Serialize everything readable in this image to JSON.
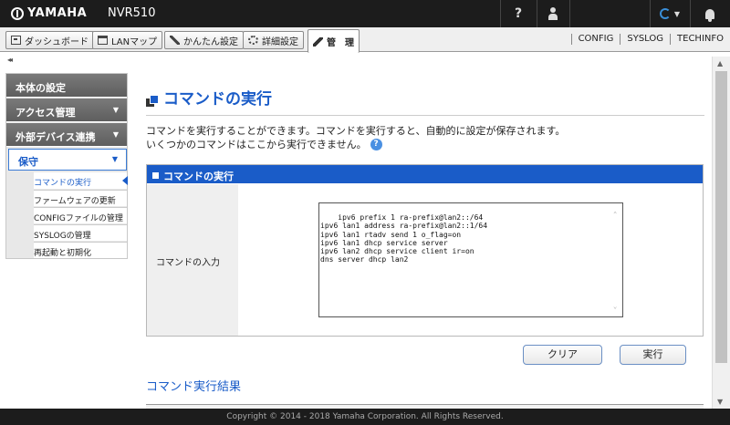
{
  "topbar": {
    "brand": "YAMAHA",
    "device": "NVR510",
    "help_label": "?",
    "icons": [
      "yamaha-logo-icon",
      "help-icon",
      "user-icon",
      "status-spinner-icon",
      "bell-icon"
    ],
    "colors": {
      "topbar_bg": "#1c1c1c",
      "accent": "#1a5cc8"
    }
  },
  "menubar": {
    "buttons": [
      "ダッシュボード",
      "LANマップ",
      "かんたん設定",
      "詳細設定",
      "管　理"
    ],
    "links": [
      "CONFIG",
      "SYSLOG",
      "TECHINFO"
    ]
  },
  "sidebar": {
    "collapse": "◂◂",
    "items": [
      "本体の設定",
      "アクセス管理",
      "外部デバイス連携",
      "保守"
    ],
    "active_item": "保守",
    "sub_items": [
      "コマンドの実行",
      "ファームウェアの更新",
      "CONFIGファイルの管理",
      "SYSLOGの管理",
      "再起動と初期化"
    ]
  },
  "main": {
    "title": "コマンドの実行",
    "desc1": "コマンドを実行することができます。コマンドを実行すると、自動的に設定が保存されます。",
    "desc2": "いくつかのコマンドはここから実行できません。",
    "panel_title": "コマンドの実行",
    "input_label": "コマンドの入力",
    "command_text": "ipv6 prefix 1 ra-prefix@lan2::/64\nipv6 lan1 address ra-prefix@lan2::1/64\nipv6 lan1 rtadv send 1 o_flag=on\nipv6 lan1 dhcp service server\nipv6 lan2 dhcp service client ir=on\ndns server dhcp lan2",
    "clear_label": "クリア",
    "run_label": "実行",
    "result_title": "コマンド実行結果"
  },
  "footer": {
    "copyright": "Copyright © 2014 - 2018 Yamaha Corporation. All Rights Reserved."
  }
}
